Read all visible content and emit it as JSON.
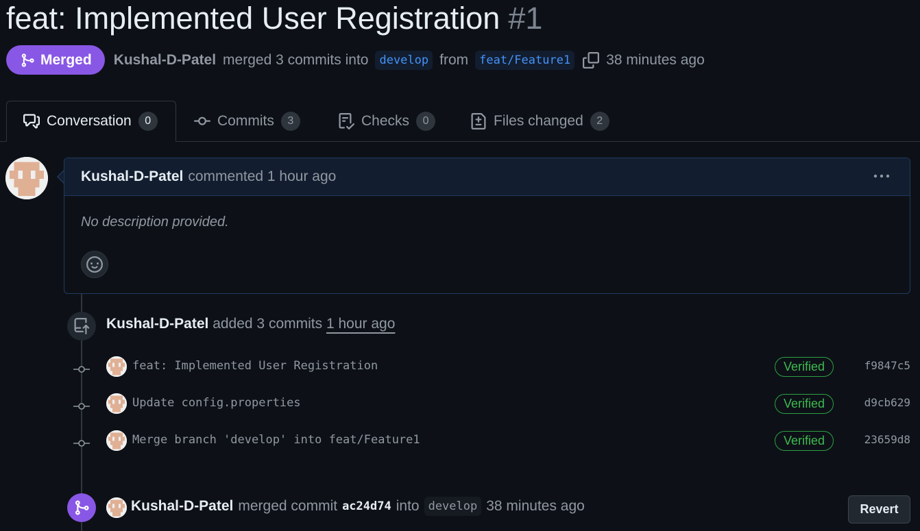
{
  "pr": {
    "title": "feat: Implemented User Registration",
    "number": "#1",
    "state_label": "Merged",
    "author": "Kushal-D-Patel",
    "merge_text_1": "merged 3 commits into",
    "base_branch": "develop",
    "from_text": "from",
    "head_branch": "feat/Feature1",
    "merged_time": "38 minutes ago"
  },
  "tabs": [
    {
      "label": "Conversation",
      "count": "0",
      "icon": "conversation-icon"
    },
    {
      "label": "Commits",
      "count": "3",
      "icon": "commit-icon"
    },
    {
      "label": "Checks",
      "count": "0",
      "icon": "checklist-icon"
    },
    {
      "label": "Files changed",
      "count": "2",
      "icon": "file-diff-icon"
    }
  ],
  "comment": {
    "author": "Kushal-D-Patel",
    "action": "commented 1 hour ago",
    "body": "No description provided.",
    "menu_icon": "kebab-horizontal-icon",
    "reaction_icon": "smiley-icon"
  },
  "commits_event": {
    "author": "Kushal-D-Patel",
    "action": "added 3 commits",
    "time": "1 hour ago",
    "icon": "repo-push-icon"
  },
  "commits": [
    {
      "message": "feat: Implemented User Registration",
      "badge": "Verified",
      "sha": "f9847c5"
    },
    {
      "message": "Update config.properties",
      "badge": "Verified",
      "sha": "d9cb629"
    },
    {
      "message": "Merge branch 'develop' into feat/Feature1",
      "badge": "Verified",
      "sha": "23659d8"
    }
  ],
  "merge_event": {
    "author": "Kushal-D-Patel",
    "action": "merged commit",
    "sha": "ac24d74",
    "into": "into",
    "branch": "develop",
    "time": "38 minutes ago",
    "revert_label": "Revert",
    "icon": "git-merge-icon"
  },
  "colors": {
    "background": "#0d1117",
    "merged_purple": "#8957e5",
    "verified_green": "#3fb950",
    "branch_blue": "#4493f8"
  }
}
